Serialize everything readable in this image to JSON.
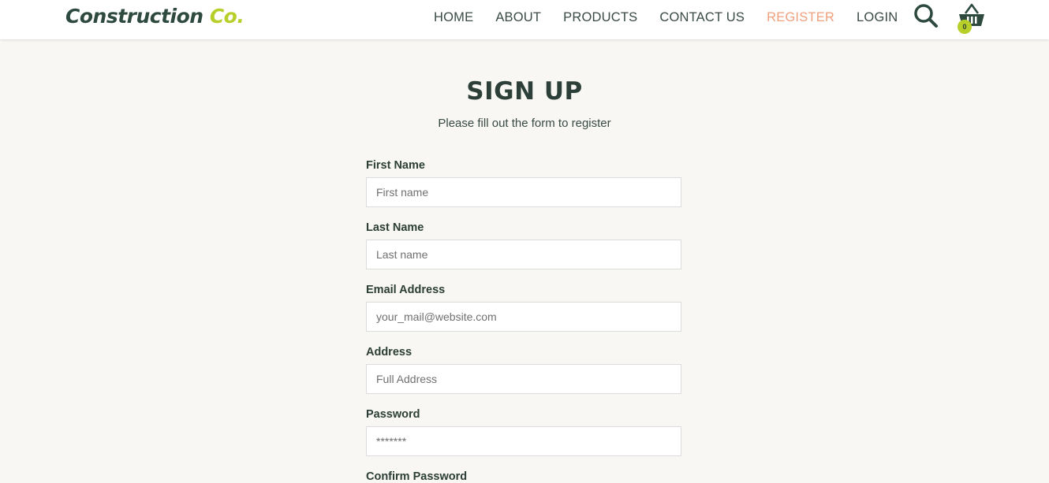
{
  "brand": {
    "name_main": "Construction",
    "name_accent": "Co.",
    "accent_color": "#b8cf2a",
    "primary_color": "#2e4a3f"
  },
  "nav": {
    "items": [
      {
        "label": "HOME",
        "active": false
      },
      {
        "label": "ABOUT",
        "active": false
      },
      {
        "label": "PRODUCTS",
        "active": false
      },
      {
        "label": "CONTACT US",
        "active": false
      },
      {
        "label": "REGISTER",
        "active": true
      },
      {
        "label": "LOGIN",
        "active": false
      }
    ],
    "active_color": "#f0a07d",
    "search_icon": "search-icon",
    "cart_icon": "basket-icon",
    "cart_count": "0"
  },
  "page": {
    "title": "SIGN UP",
    "subtitle": "Please fill out the form to register"
  },
  "form": {
    "fields": [
      {
        "label": "First Name",
        "placeholder": "First name",
        "type": "text"
      },
      {
        "label": "Last Name",
        "placeholder": "Last name",
        "type": "text"
      },
      {
        "label": "Email Address",
        "placeholder": "your_mail@website.com",
        "type": "email"
      },
      {
        "label": "Address",
        "placeholder": "Full Address",
        "type": "text"
      },
      {
        "label": "Password",
        "placeholder": "*******",
        "type": "password"
      },
      {
        "label": "Confirm Password",
        "placeholder": "",
        "type": "password"
      }
    ]
  }
}
